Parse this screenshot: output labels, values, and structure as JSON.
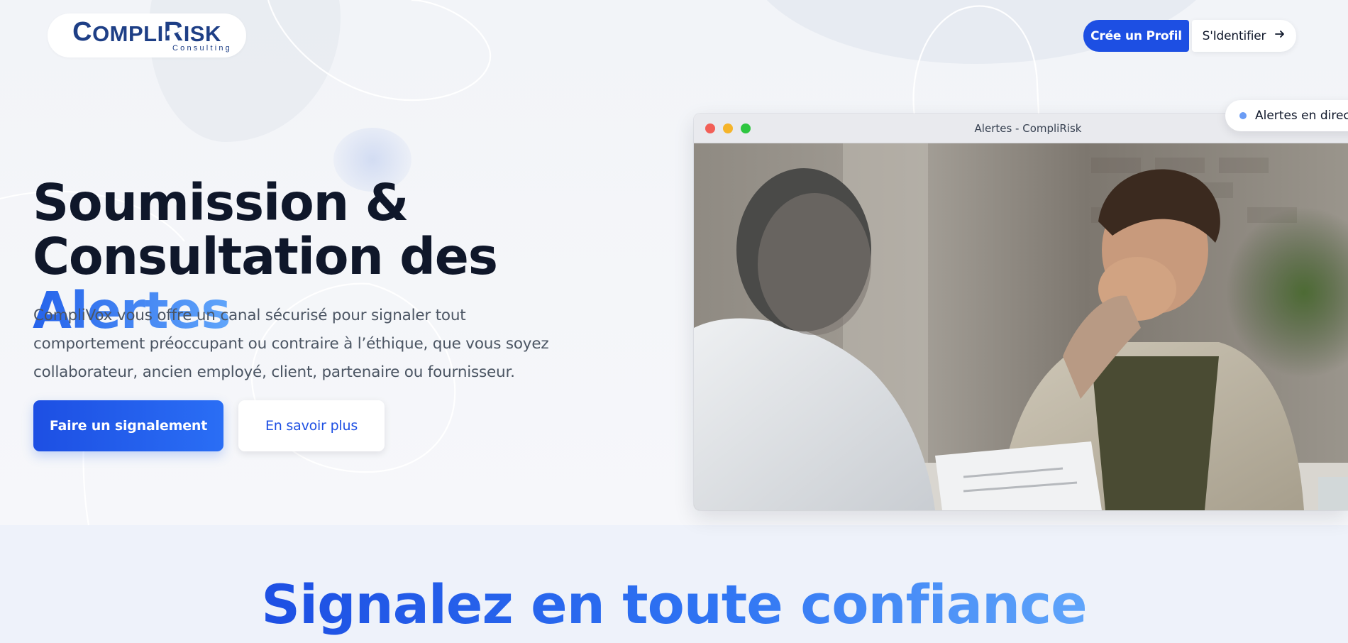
{
  "header": {
    "logo": {
      "brand": "CompliRisk",
      "sub": "Consulting"
    },
    "create_profile_label": "Crée un Profil",
    "login_label": "S'Identifier"
  },
  "hero": {
    "title_line1": "Soumission &",
    "title_line2_prefix": "Consultation des",
    "title_accent": "Alertes",
    "description": "CompliVox vous offre un canal sécurisé pour signaler tout comportement préoccupant ou contraire à l’éthique, que vous soyez collaborateur, ancien employé, client, partenaire ou fournisseur.",
    "primary_button": "Faire un signalement",
    "secondary_button": "En savoir plus"
  },
  "window": {
    "title": "Alertes - CompliRisk",
    "image_alt": "stressed-man-in-meeting-photo"
  },
  "live_badge": {
    "label": "Alertes en direct"
  },
  "section2": {
    "title": "Signalez en toute confiance"
  },
  "colors": {
    "primary": "#1d4fe3",
    "accent_light": "#60a5fa",
    "text_dark": "#0f172a",
    "text_muted": "#4b5563",
    "logo_navy": "#1e3f86"
  },
  "icons": {
    "login": "arrow-right-icon",
    "live": "status-dot-icon"
  }
}
